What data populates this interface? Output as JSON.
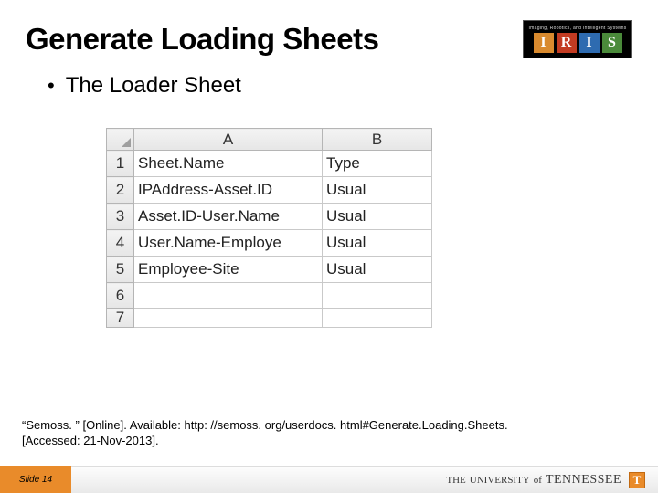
{
  "title": "Generate Loading Sheets",
  "logo": {
    "top_text": "Imaging, Robotics, and Intelligent Systems",
    "letters": [
      "I",
      "R",
      "I",
      "S"
    ]
  },
  "bullet": {
    "text": "The Loader Sheet"
  },
  "sheet": {
    "columns": [
      "A",
      "B"
    ],
    "row_headers": [
      "1",
      "2",
      "3",
      "4",
      "5",
      "6",
      "7"
    ],
    "rows": [
      {
        "a": "Sheet.Name",
        "b": "Type"
      },
      {
        "a": "IPAddress-Asset.ID",
        "b": "Usual"
      },
      {
        "a": "Asset.ID-User.Name",
        "b": "Usual"
      },
      {
        "a": "User.Name-Employe",
        "b": "Usual"
      },
      {
        "a": "Employee-Site",
        "b": "Usual"
      },
      {
        "a": "",
        "b": ""
      },
      {
        "a": "",
        "b": ""
      }
    ]
  },
  "citation": {
    "line1": "“Semoss. ” [Online]. Available: http: //semoss. org/userdocs. html#Generate.Loading.Sheets.",
    "line2": "[Accessed: 21-Nov-2013]."
  },
  "footer": {
    "slide_label": "Slide 14",
    "university_small_1": "THE",
    "university_word": "UNIVERSITY",
    "university_small_2": "of",
    "university_name": "TENNESSEE",
    "t_glyph": "T"
  }
}
